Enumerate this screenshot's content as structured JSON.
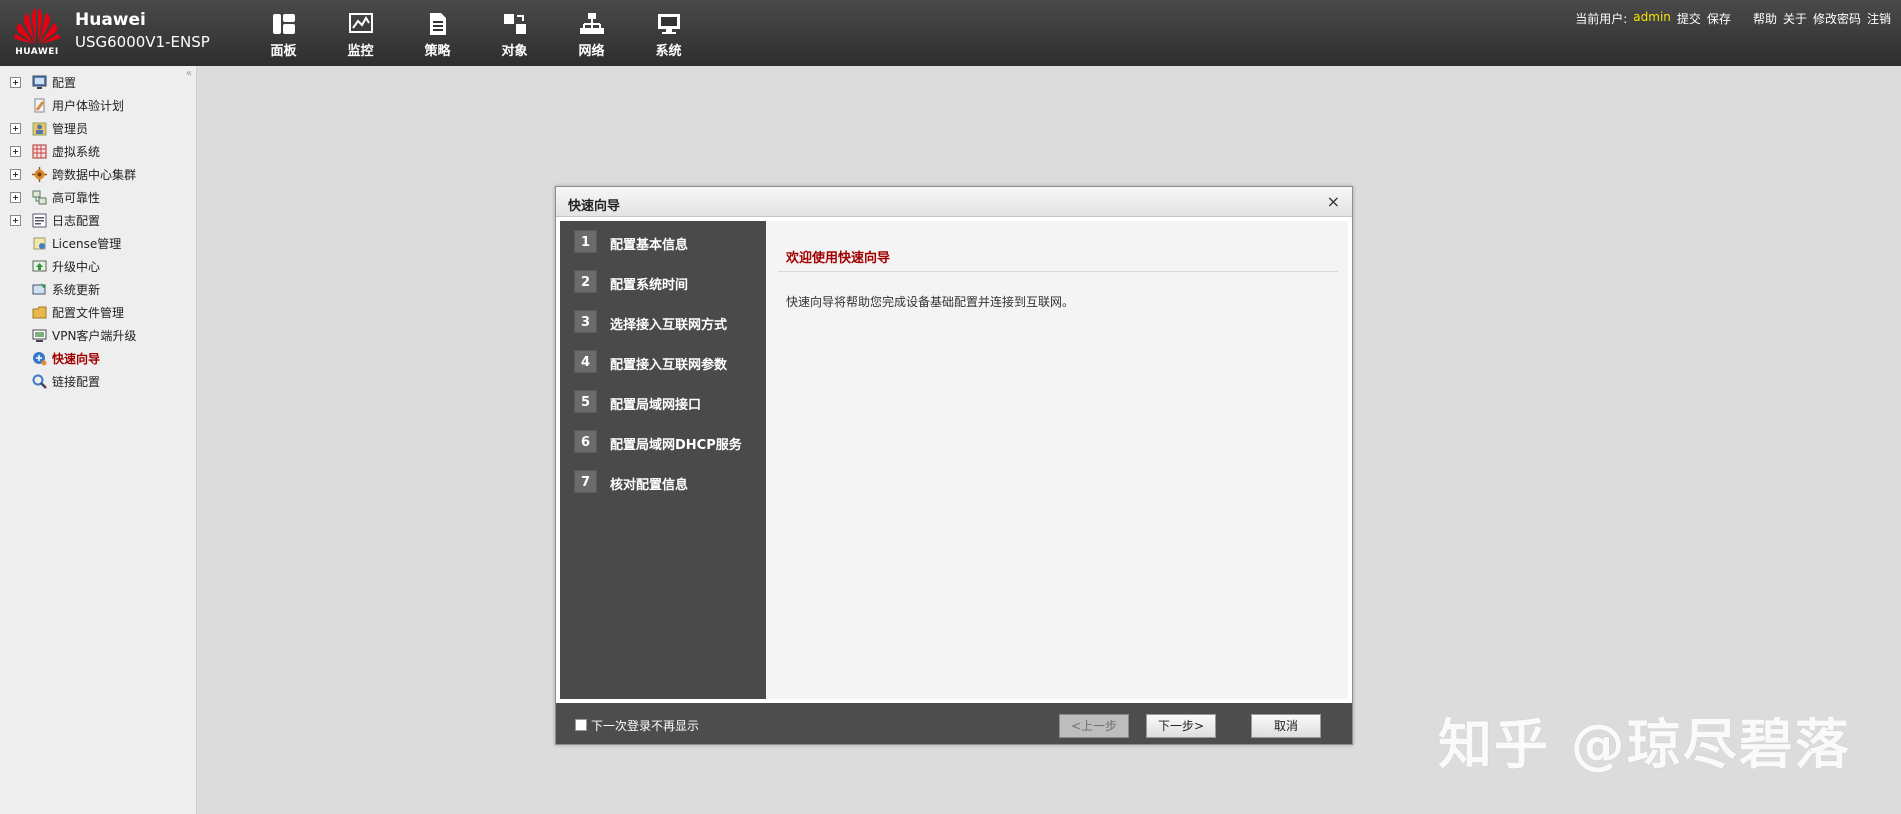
{
  "header": {
    "logo_text": "HUAWEI",
    "brand_line1": "Huawei",
    "brand_line2": "USG6000V1-ENSP",
    "nav": [
      {
        "label": "面板",
        "icon": "dashboard-icon"
      },
      {
        "label": "监控",
        "icon": "monitor-icon"
      },
      {
        "label": "策略",
        "icon": "policy-icon"
      },
      {
        "label": "对象",
        "icon": "object-icon"
      },
      {
        "label": "网络",
        "icon": "network-icon"
      },
      {
        "label": "系统",
        "icon": "system-icon"
      }
    ],
    "current_user_label": "当前用户:",
    "username": "admin",
    "commit": "提交",
    "save": "保存",
    "help": "帮助",
    "about": "关于",
    "change_password": "修改密码",
    "logout": "注销"
  },
  "sidebar": {
    "collapse": "«",
    "items": [
      {
        "label": "配置",
        "expandable": true,
        "icon": "config-icon"
      },
      {
        "label": "用户体验计划",
        "expandable": false,
        "icon": "user-experience-icon"
      },
      {
        "label": "管理员",
        "expandable": true,
        "icon": "admin-icon"
      },
      {
        "label": "虚拟系统",
        "expandable": true,
        "icon": "virtual-system-icon"
      },
      {
        "label": "跨数据中心集群",
        "expandable": true,
        "icon": "cluster-icon"
      },
      {
        "label": "高可靠性",
        "expandable": true,
        "icon": "high-availability-icon"
      },
      {
        "label": "日志配置",
        "expandable": true,
        "icon": "log-config-icon"
      },
      {
        "label": "License管理",
        "expandable": false,
        "icon": "license-icon"
      },
      {
        "label": "升级中心",
        "expandable": false,
        "icon": "upgrade-icon"
      },
      {
        "label": "系统更新",
        "expandable": false,
        "icon": "system-update-icon"
      },
      {
        "label": "配置文件管理",
        "expandable": false,
        "icon": "config-file-icon"
      },
      {
        "label": "VPN客户端升级",
        "expandable": false,
        "icon": "vpn-icon"
      },
      {
        "label": "快速向导",
        "expandable": false,
        "icon": "wizard-icon",
        "active": true
      },
      {
        "label": "链接配置",
        "expandable": false,
        "icon": "link-config-icon"
      }
    ]
  },
  "dialog": {
    "title": "快速向导",
    "close": "×",
    "steps": [
      {
        "num": "1",
        "label": "配置基本信息"
      },
      {
        "num": "2",
        "label": "配置系统时间"
      },
      {
        "num": "3",
        "label": "选择接入互联网方式"
      },
      {
        "num": "4",
        "label": "配置接入互联网参数"
      },
      {
        "num": "5",
        "label": "配置局域网接口"
      },
      {
        "num": "6",
        "label": "配置局域网DHCP服务"
      },
      {
        "num": "7",
        "label": "核对配置信息"
      }
    ],
    "welcome_title": "欢迎使用快速向导",
    "description": "快速向导将帮助您完成设备基础配置并连接到互联网。",
    "checkbox_label": "下一次登录不再显示",
    "prev_button": "<上一步",
    "next_button": "下一步>",
    "cancel_button": "取消"
  },
  "watermark": "知乎 @琼尽碧落",
  "colors": {
    "header_bg": "#3a3a3a",
    "username": "#f3e400",
    "active_item": "#a00000",
    "huawei_red": "#e60012",
    "step_panel": "#4a4a4a"
  }
}
